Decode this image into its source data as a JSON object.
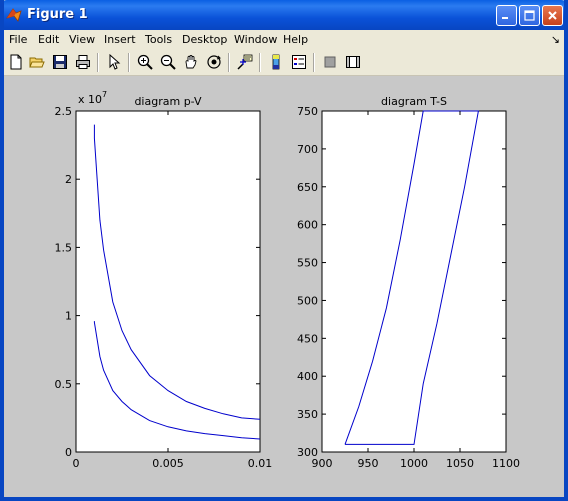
{
  "window": {
    "title": "Figure 1"
  },
  "menu": [
    "File",
    "Edit",
    "View",
    "Insert",
    "Tools",
    "Desktop",
    "Window",
    "Help"
  ],
  "menu_overflow": "↘",
  "toolbar": [
    "new-file-icon",
    "open-folder-icon",
    "save-icon",
    "print-icon",
    "pointer-icon",
    "zoom-in-icon",
    "zoom-out-icon",
    "pan-hand-icon",
    "rotate-3d-icon",
    "data-cursor-icon",
    "colorbar-icon",
    "legend-icon",
    "hide-plot-tools-icon",
    "show-plot-tools-icon"
  ],
  "colors": {
    "line": "#0000cc",
    "figure_bg": "#c8c8c8",
    "axes_bg": "#ffffff"
  },
  "chart_data": [
    {
      "type": "line",
      "title": "diagram p-V",
      "xlabel": "",
      "ylabel": "",
      "exponent_label": "x 10",
      "exponent_power": "7",
      "xlim": [
        0,
        0.01
      ],
      "ylim": [
        0,
        25000000
      ],
      "xticks": [
        0,
        0.005,
        0.01
      ],
      "xtick_labels": [
        "0",
        "0.005",
        "0.01"
      ],
      "yticks": [
        0,
        5000000,
        10000000,
        15000000,
        20000000,
        25000000
      ],
      "ytick_labels": [
        "0",
        "0.5",
        "1",
        "1.5",
        "2",
        "2.5"
      ],
      "series": [
        {
          "x": [
            0.001,
            0.001,
            0.0013,
            0.0015,
            0.002,
            0.0025,
            0.003,
            0.004,
            0.005,
            0.006,
            0.007,
            0.008,
            0.009,
            0.01
          ],
          "y": [
            24000000,
            23000000,
            17000000,
            14800000,
            11000000,
            8900000,
            7500000,
            5600000,
            4500000,
            3700000,
            3200000,
            2800000,
            2500000,
            2400000
          ]
        },
        {
          "x": [
            0.001,
            0.001,
            0.0013,
            0.0015,
            0.002,
            0.0025,
            0.003,
            0.004,
            0.005,
            0.006,
            0.007,
            0.008,
            0.009,
            0.01
          ],
          "y": [
            9600000,
            9500000,
            7000000,
            6000000,
            4500000,
            3700000,
            3100000,
            2300000,
            1850000,
            1550000,
            1350000,
            1200000,
            1050000,
            950000
          ]
        }
      ]
    },
    {
      "type": "line",
      "title": "diagram T-S",
      "xlabel": "",
      "ylabel": "",
      "xlim": [
        900,
        1100
      ],
      "ylim": [
        300,
        750
      ],
      "xticks": [
        900,
        950,
        1000,
        1050,
        1100
      ],
      "xtick_labels": [
        "900",
        "950",
        "1000",
        "1050",
        "1100"
      ],
      "yticks": [
        300,
        350,
        400,
        450,
        500,
        550,
        600,
        650,
        700,
        750
      ],
      "ytick_labels": [
        "300",
        "350",
        "400",
        "450",
        "500",
        "550",
        "600",
        "650",
        "700",
        "750"
      ],
      "series": [
        {
          "x": [
            925,
            1000,
            1010,
            1025,
            1040,
            1055,
            1070,
            1010,
            1000,
            985,
            970,
            955,
            940,
            925
          ],
          "y": [
            310,
            310,
            390,
            470,
            560,
            650,
            750,
            750,
            680,
            580,
            490,
            420,
            360,
            310
          ]
        }
      ]
    }
  ]
}
